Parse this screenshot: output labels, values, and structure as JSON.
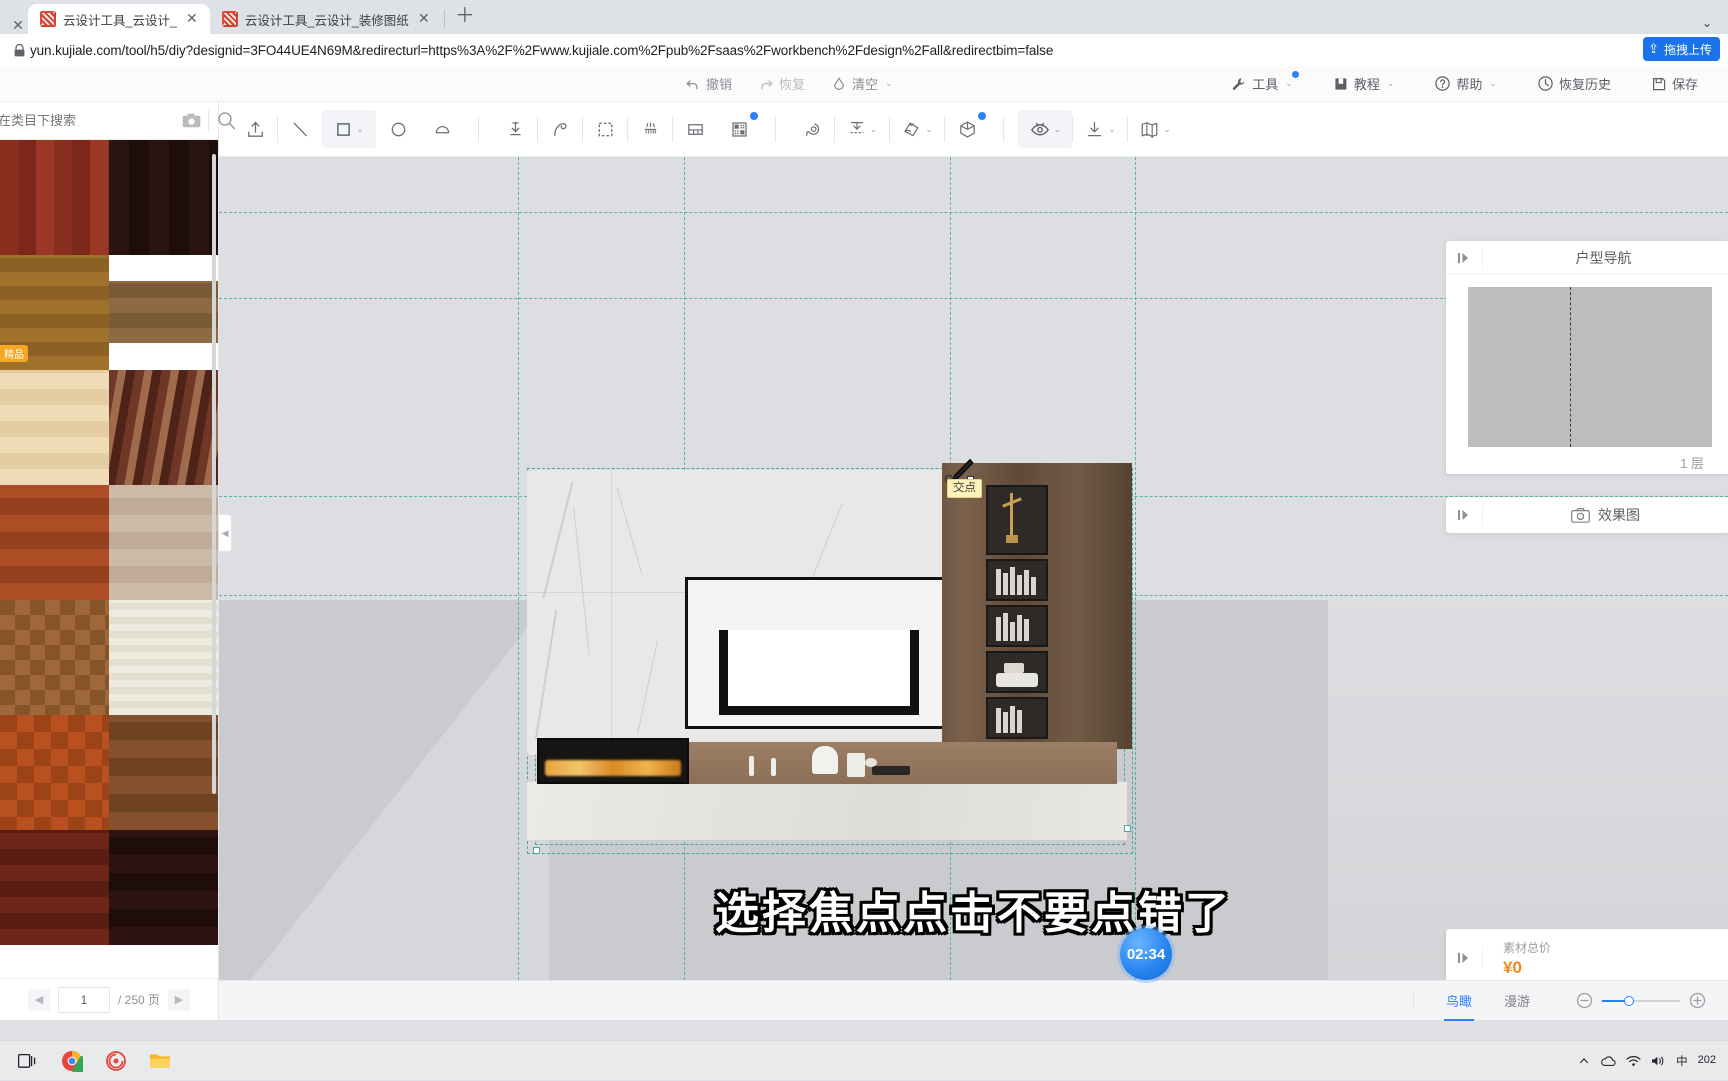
{
  "browser": {
    "tabs": [
      {
        "title": "云设计工具_云设计_",
        "close": "✕",
        "active": true
      },
      {
        "title": "云设计工具_云设计_装修图纸",
        "close": "✕",
        "active": false
      }
    ],
    "leading_close": "✕",
    "new_tab": "＋",
    "url": "yun.kujiale.com/tool/h5/diy?designid=3FO44UE4N69M&redirecturl=https%3A%2F%2Fwww.kujiale.com%2Fpub%2Fsaas%2Fworkbench%2Fdesign%2Fall&redirectbim=false",
    "lock_icon": "lock-icon",
    "extension_pill": "拖拽上传",
    "window_controls": [
      "⌄",
      "▭",
      "✕"
    ]
  },
  "menubar": {
    "center": [
      {
        "label": "撤销",
        "icon": "undo-icon",
        "state": "enabled"
      },
      {
        "label": "恢复",
        "icon": "redo-icon",
        "state": "disabled"
      },
      {
        "label": "清空",
        "icon": "clear-icon",
        "caret": "⌄",
        "state": "enabled"
      }
    ],
    "right": [
      {
        "label": "工具",
        "icon": "wrench-icon",
        "caret": "⌄",
        "dot": true
      },
      {
        "label": "教程",
        "icon": "book-icon",
        "caret": "⌄",
        "dot": false
      },
      {
        "label": "帮助",
        "icon": "question-icon",
        "caret": "⌄",
        "dot": false
      },
      {
        "label": "恢复历史",
        "icon": "history-icon",
        "caret": "",
        "dot": false
      },
      {
        "label": "保存",
        "icon": "save-icon",
        "caret": "",
        "dot": false
      }
    ]
  },
  "toolbar": {
    "buttons": [
      {
        "name": "upload-icon",
        "caret": false,
        "dot": false,
        "selected": false
      },
      {
        "name": "line-tool-icon",
        "caret": false,
        "dot": false,
        "selected": false
      },
      {
        "name": "rectangle-tool-icon",
        "caret": true,
        "dot": false,
        "selected": true
      },
      {
        "name": "circle-tool-icon",
        "caret": false,
        "dot": false,
        "selected": false
      },
      {
        "name": "arc-tool-icon",
        "caret": false,
        "dot": false,
        "selected": false
      },
      {
        "name": "import-model-icon",
        "caret": false,
        "dot": false,
        "selected": false
      },
      {
        "name": "curve-wall-icon",
        "caret": false,
        "dot": false,
        "selected": false
      },
      {
        "name": "select-area-icon",
        "caret": false,
        "dot": false,
        "selected": false
      },
      {
        "name": "ceiling-icon",
        "caret": false,
        "dot": false,
        "selected": false
      },
      {
        "name": "floorplan-split-icon",
        "caret": false,
        "dot": false,
        "selected": false
      },
      {
        "name": "mosaic-icon",
        "caret": false,
        "dot": false,
        "selected": true
      },
      {
        "name": "measure-tape-icon",
        "caret": false,
        "dot": false,
        "selected": false
      },
      {
        "name": "align-icon",
        "caret": true,
        "dot": false,
        "selected": false
      },
      {
        "name": "paint-brush-icon",
        "caret": true,
        "dot": false,
        "selected": false
      },
      {
        "name": "cube-icon",
        "caret": false,
        "dot": true,
        "selected": false
      },
      {
        "name": "eye-visibility-icon",
        "caret": true,
        "dot": false,
        "selected": true
      },
      {
        "name": "download-icon",
        "caret": true,
        "dot": false,
        "selected": false
      },
      {
        "name": "layout-map-icon",
        "caret": true,
        "dot": false,
        "selected": false
      }
    ]
  },
  "left_panel": {
    "search_placeholder": "在类目下搜索",
    "camera_icon": "camera-search-icon",
    "search_icon": "search-icon",
    "badge": "精品",
    "swatch_colors": [
      "#8e2f20",
      "#2a1410",
      "#9c6c26",
      "#ffffff",
      "#ecd9b0",
      "#6e3a2a",
      "#a84b26",
      "#c9b5a2",
      "#9a6436",
      "#ece8dd",
      "#b5461f",
      "#7a4526",
      "#6e2417",
      "#2b1410"
    ],
    "pagination": {
      "prev": "◀",
      "current": "1",
      "total": "/ 250 页",
      "next": "▶"
    },
    "collapse_icon": "collapse-panel-icon"
  },
  "canvas": {
    "snap_tooltip": "交点",
    "cursor": "pen-cursor",
    "subtitle": "选择焦点点击不要点错了"
  },
  "right_panels": {
    "navigator": {
      "title": "户型导航",
      "toggle_icon": "expand-panel-icon",
      "floor_label": "1 层"
    },
    "render": {
      "title": "效果图",
      "icon": "camera-icon",
      "toggle_icon": "expand-panel-icon"
    },
    "price": {
      "label": "素材总价",
      "value": "¥0",
      "toggle_icon": "expand-panel-icon"
    }
  },
  "bottom_bar": {
    "view_modes": [
      {
        "label": "鸟瞰",
        "active": true
      },
      {
        "label": "漫游",
        "active": false
      }
    ],
    "zoom_out_icon": "zoom-out-icon",
    "zoom_in_icon": "zoom-in-icon"
  },
  "timer": {
    "value": "02:34"
  },
  "taskbar": {
    "icons": [
      "task-view-icon",
      "chrome-icon",
      "recorder-icon",
      "file-explorer-icon"
    ],
    "tray": [
      "caret-up-icon",
      "onedrive-icon",
      "network-icon",
      "volume-icon",
      "ime-cn",
      "ime-abc"
    ],
    "clock": "202"
  },
  "colors": {
    "accent": "#2d7ff9",
    "price": "#f0881a",
    "guide": "#4aa893",
    "tooltip_bg": "#fdf2b8"
  }
}
